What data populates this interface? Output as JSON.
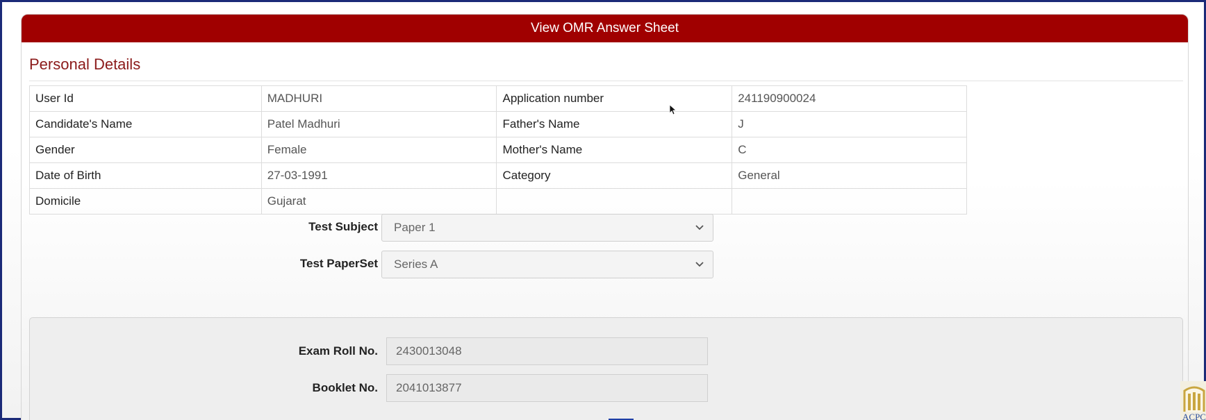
{
  "header": {
    "title": "View OMR Answer Sheet"
  },
  "personal": {
    "title": "Personal Details",
    "rows": [
      [
        "User Id",
        "MADHURI",
        "Application number",
        "241190900024"
      ],
      [
        "Candidate's Name",
        "Patel Madhuri",
        "Father's Name",
        "J"
      ],
      [
        "Gender",
        "Female",
        "Mother's Name",
        "C"
      ],
      [
        "Date of Birth",
        "27-03-1991",
        "Category",
        "General"
      ],
      [
        "Domicile",
        "Gujarat",
        "",
        ""
      ]
    ]
  },
  "test": {
    "subject_label": "Test Subject",
    "subject_value": "Paper 1",
    "paperset_label": "Test PaperSet",
    "paperset_value": "Series A"
  },
  "exam": {
    "roll_label": "Exam Roll No.",
    "roll_value": "2430013048",
    "booklet_label": "Booklet No.",
    "booklet_value": "2041013877"
  },
  "logo": {
    "text": "ACPC",
    "color": "#2a4d9b"
  },
  "colors": {
    "header": "#a00000",
    "title": "#8b1a1a",
    "frame": "#1b2a78"
  }
}
